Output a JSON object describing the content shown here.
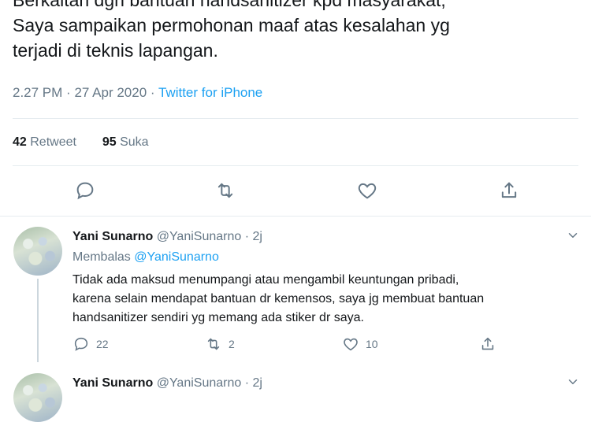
{
  "tweet": {
    "lines": [
      "Berkaitan dgn bantuan handsanitizer kpd masyarakat,",
      "Saya sampaikan permohonan maaf atas kesalahan yg",
      "terjadi di teknis lapangan."
    ],
    "time": "2.27 PM",
    "date": "27 Apr 2020",
    "separator": "·",
    "source": "Twitter for iPhone",
    "retweet_count": "42",
    "retweet_label": "Retweet",
    "like_count": "95",
    "like_label": "Suka"
  },
  "actions": {
    "icons": [
      "reply-icon",
      "retweet-icon",
      "like-icon",
      "share-icon"
    ]
  },
  "replies": [
    {
      "name": "Yani Sunarno",
      "handle": "@YaniSunarno",
      "dot": "·",
      "age": "2j",
      "replying_prefix": "Membalas",
      "replying_to": "@YaniSunarno",
      "lines": [
        "Tidak ada maksud menumpangi atau mengambil keuntungan pribadi,",
        "karena selain mendapat bantuan dr kemensos, saya jg membuat bantuan",
        "handsanitizer sendiri yg memang ada stiker dr saya."
      ],
      "reply_count": "22",
      "retweet_count": "2",
      "like_count": "10"
    },
    {
      "name": "Yani Sunarno",
      "handle": "@YaniSunarno",
      "dot": "·",
      "age": "2j"
    }
  ],
  "colors": {
    "accent": "#1da1f2",
    "muted": "#657786",
    "text": "#14171a",
    "border": "#e6ecf0"
  }
}
